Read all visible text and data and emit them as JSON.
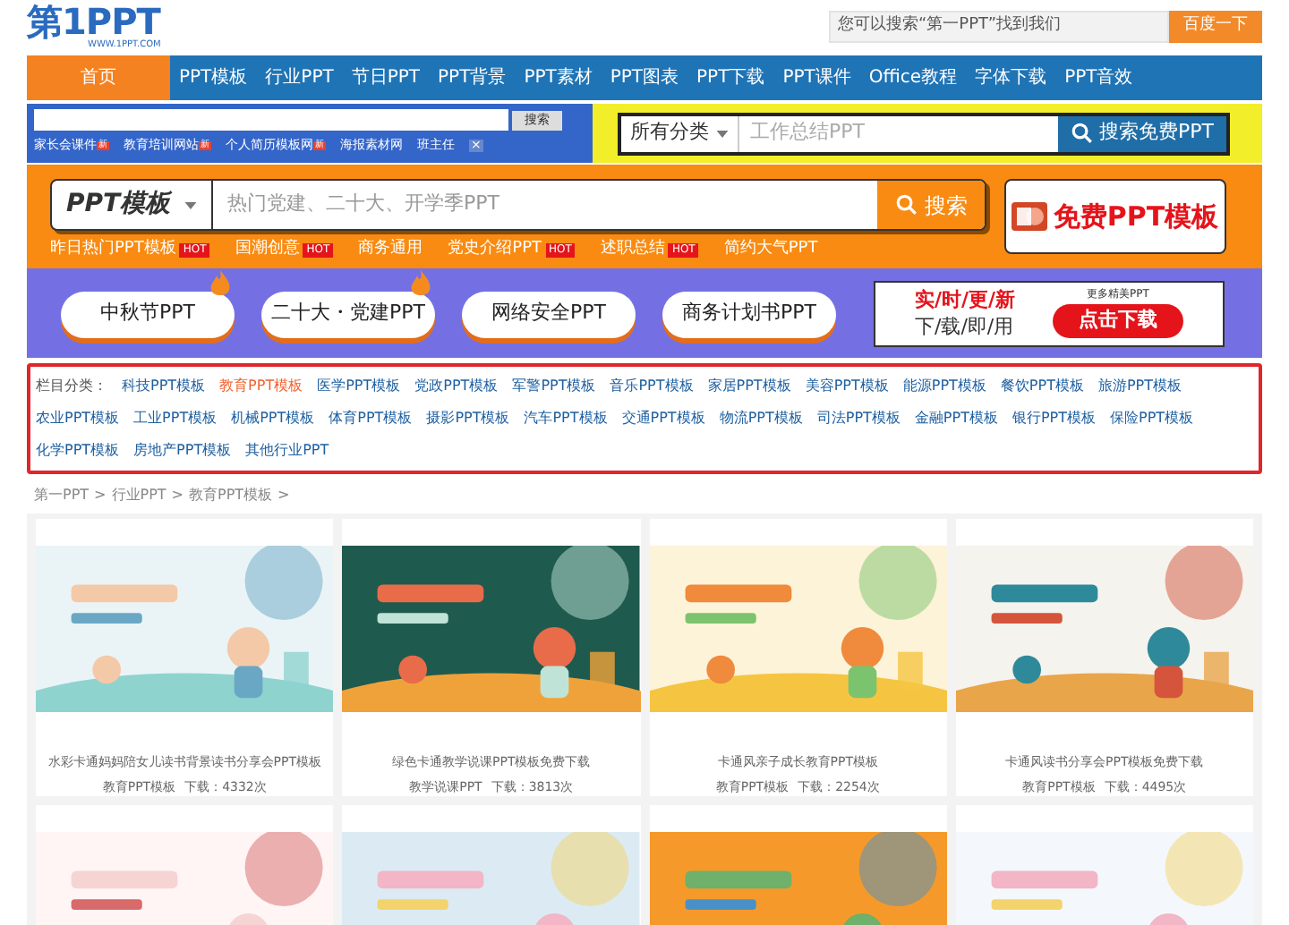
{
  "header": {
    "logo": "第1PPT",
    "logo_sub": "WWW.1PPT.COM",
    "search_placeholder": "您可以搜索“第一PPT”找到我们",
    "search_button": "百度一下"
  },
  "nav": [
    {
      "label": "首页",
      "selected": true
    },
    {
      "label": "PPT模板",
      "selected": false
    },
    {
      "label": "行业PPT",
      "selected": false
    },
    {
      "label": "节日PPT",
      "selected": false
    },
    {
      "label": "PPT背景",
      "selected": false
    },
    {
      "label": "PPT素材",
      "selected": false
    },
    {
      "label": "PPT图表",
      "selected": false
    },
    {
      "label": "PPT下载",
      "selected": false
    },
    {
      "label": "PPT课件",
      "selected": false
    },
    {
      "label": "Office教程",
      "selected": false
    },
    {
      "label": "字体下载",
      "selected": false
    },
    {
      "label": "PPT音效",
      "selected": false
    }
  ],
  "site_search": {
    "button": "搜索",
    "links": [
      {
        "label": "家长会课件",
        "badge": "新"
      },
      {
        "label": "教育培训网站",
        "badge": "新"
      },
      {
        "label": "个人简历模板网",
        "badge": "新"
      },
      {
        "label": "海报素材网"
      },
      {
        "label": "班主任"
      }
    ],
    "close": "×"
  },
  "free_search": {
    "category": "所有分类",
    "placeholder": "工作总结PPT",
    "button": "搜索免费PPT"
  },
  "template_search": {
    "category": "PPT模板",
    "placeholder": "热门党建、二十大、开学季PPT",
    "button": "搜索",
    "promo": "免费PPT模板",
    "hot_links": [
      {
        "label": "昨日热门PPT模板",
        "badge": "HOT"
      },
      {
        "label": "国潮创意",
        "badge": "HOT"
      },
      {
        "label": "商务通用"
      },
      {
        "label": "党史介绍PPT",
        "badge": "HOT"
      },
      {
        "label": "述职总结",
        "badge": "HOT"
      },
      {
        "label": "简约大气PPT"
      }
    ]
  },
  "topics": [
    {
      "label": "中秋节PPT",
      "hot": true
    },
    {
      "label": "二十大・党建PPT",
      "hot": true
    },
    {
      "label": "网络安全PPT",
      "hot": false
    },
    {
      "label": "商务计划书PPT",
      "hot": false
    }
  ],
  "download_ad": {
    "line1": "实/时/更/新",
    "line2": "下/载/即/用",
    "small": "更多精美PPT",
    "button": "点击下载"
  },
  "categories": {
    "label": "栏目分类：",
    "items": [
      {
        "label": "科技PPT模板",
        "selected": false
      },
      {
        "label": "教育PPT模板",
        "selected": true
      },
      {
        "label": "医学PPT模板",
        "selected": false
      },
      {
        "label": "党政PPT模板",
        "selected": false
      },
      {
        "label": "军警PPT模板",
        "selected": false
      },
      {
        "label": "音乐PPT模板",
        "selected": false
      },
      {
        "label": "家居PPT模板",
        "selected": false
      },
      {
        "label": "美容PPT模板",
        "selected": false
      },
      {
        "label": "能源PPT模板",
        "selected": false
      },
      {
        "label": "餐饮PPT模板",
        "selected": false
      },
      {
        "label": "旅游PPT模板",
        "selected": false
      },
      {
        "label": "农业PPT模板",
        "selected": false
      },
      {
        "label": "工业PPT模板",
        "selected": false
      },
      {
        "label": "机械PPT模板",
        "selected": false
      },
      {
        "label": "体育PPT模板",
        "selected": false
      },
      {
        "label": "摄影PPT模板",
        "selected": false
      },
      {
        "label": "汽车PPT模板",
        "selected": false
      },
      {
        "label": "交通PPT模板",
        "selected": false
      },
      {
        "label": "物流PPT模板",
        "selected": false
      },
      {
        "label": "司法PPT模板",
        "selected": false
      },
      {
        "label": "金融PPT模板",
        "selected": false
      },
      {
        "label": "银行PPT模板",
        "selected": false
      },
      {
        "label": "保险PPT模板",
        "selected": false
      },
      {
        "label": "化学PPT模板",
        "selected": false
      },
      {
        "label": "房地产PPT模板",
        "selected": false
      },
      {
        "label": "其他行业PPT",
        "selected": false
      }
    ]
  },
  "breadcrumb": [
    "第一PPT",
    "行业PPT",
    "教育PPT模板"
  ],
  "breadcrumb_separator": ">",
  "cards": [
    {
      "thumbnail": {
        "kind": "picture"
      },
      "title": "水彩卡通妈妈陪女儿读书背景读书分享会PPT模板",
      "category": "教育PPT模板",
      "downloads": "下载：4332次"
    },
    {
      "thumbnail": {
        "kind": "picture"
      },
      "title": "绿色卡通教学说课PPT模板免费下载",
      "category": "教学说课PPT",
      "downloads": "下载：3813次"
    },
    {
      "thumbnail": {
        "kind": "picture"
      },
      "title": "卡通风亲子成长教育PPT模板",
      "category": "教育PPT模板",
      "downloads": "下载：2254次"
    },
    {
      "thumbnail": {
        "kind": "picture"
      },
      "title": "卡通风读书分享会PPT模板免费下载",
      "category": "教育PPT模板",
      "downloads": "下载：4495次"
    },
    {
      "thumbnail": {
        "kind": "picture"
      }
    },
    {
      "thumbnail": {
        "kind": "picture"
      }
    },
    {
      "thumbnail": {
        "kind": "picture"
      }
    },
    {
      "thumbnail": {
        "kind": "picture"
      }
    }
  ]
}
